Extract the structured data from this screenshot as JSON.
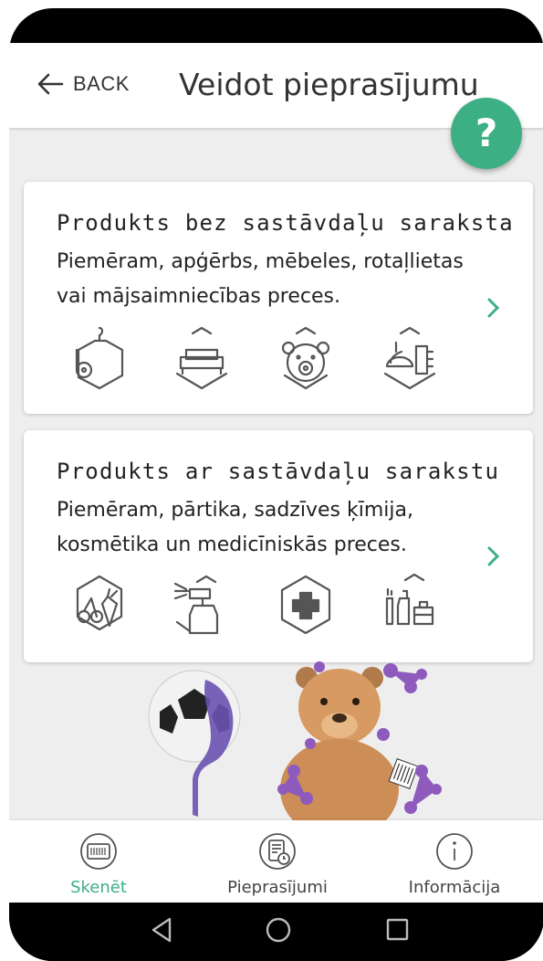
{
  "header": {
    "back_label": "BACK",
    "title": "Veidot pieprasījumu",
    "help_label": "?"
  },
  "cards": [
    {
      "title": "Produkts bez sastāvdaļu saraksta",
      "description": "Piemēram, apģērbs, mēbeles, rotaļlietas vai mājsaimniecības preces.",
      "icons": [
        "clothing-icon",
        "sofa-icon",
        "teddy-bear-icon",
        "cleaning-icon"
      ]
    },
    {
      "title": "Produkts ar sastāvdaļu sarakstu",
      "description": "Piemēram, pārtika, sadzīves ķīmija, kosmētika un medicīniskās preces.",
      "icons": [
        "fruit-vegetable-icon",
        "spray-bottle-icon",
        "medical-cross-icon",
        "cosmetics-icon"
      ]
    }
  ],
  "bottom_nav": [
    {
      "label": "Skenēt",
      "icon": "barcode-scan-icon",
      "active": true
    },
    {
      "label": "Pieprasījumi",
      "icon": "requests-icon",
      "active": false
    },
    {
      "label": "Informācija",
      "icon": "info-icon",
      "active": false
    }
  ],
  "colors": {
    "accent": "#3daf84",
    "background": "#eeeeef",
    "card": "#ffffff"
  }
}
